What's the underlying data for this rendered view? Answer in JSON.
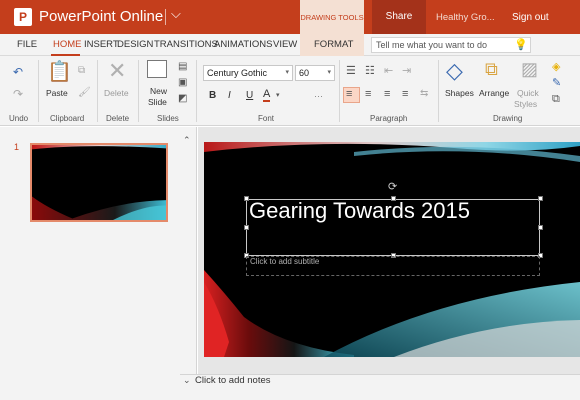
{
  "title_bar": {
    "app_logo_letter": "P",
    "app_name": "PowerPoint Online",
    "context_tab_header": "DRAWING TOOLS",
    "share_label": "Share",
    "document_name": "Healthy Gro...",
    "sign_out_label": "Sign out"
  },
  "tabs": [
    {
      "label": "FILE",
      "active": false
    },
    {
      "label": "HOME",
      "active": true
    },
    {
      "label": "INSERT",
      "active": false
    },
    {
      "label": "DESIGN",
      "active": false
    },
    {
      "label": "TRANSITIONS",
      "active": false
    },
    {
      "label": "ANIMATIONS",
      "active": false
    },
    {
      "label": "VIEW",
      "active": false
    },
    {
      "label": "FORMAT",
      "active": false
    }
  ],
  "tell_me": {
    "placeholder": "Tell me what you want to do"
  },
  "ribbon": {
    "groups": {
      "undo": "Undo",
      "clipboard": "Clipboard",
      "delete": "Delete",
      "slides": "Slides",
      "font": "Font",
      "paragraph": "Paragraph",
      "drawing": "Drawing"
    },
    "paste_label": "Paste",
    "delete_label": "Delete",
    "new_slide_line1": "New",
    "new_slide_line2": "Slide",
    "font_name": "Century Gothic",
    "font_size": "60",
    "bold": "B",
    "italic": "I",
    "underline": "U",
    "font_color": "A",
    "shapes_label": "Shapes",
    "arrange_label": "Arrange",
    "quick_styles_line1": "Quick",
    "quick_styles_line2": "Styles"
  },
  "thumbnails": [
    {
      "number": "1"
    }
  ],
  "slide": {
    "title": "Gearing Towards 2015",
    "subtitle_placeholder": "Click to add subtitle"
  },
  "notes": {
    "placeholder": "Click to add notes"
  },
  "colors": {
    "accent": "#c43e1c",
    "share_bg": "#a4321a",
    "contextual_tab_bg": "#f4e0d3"
  }
}
